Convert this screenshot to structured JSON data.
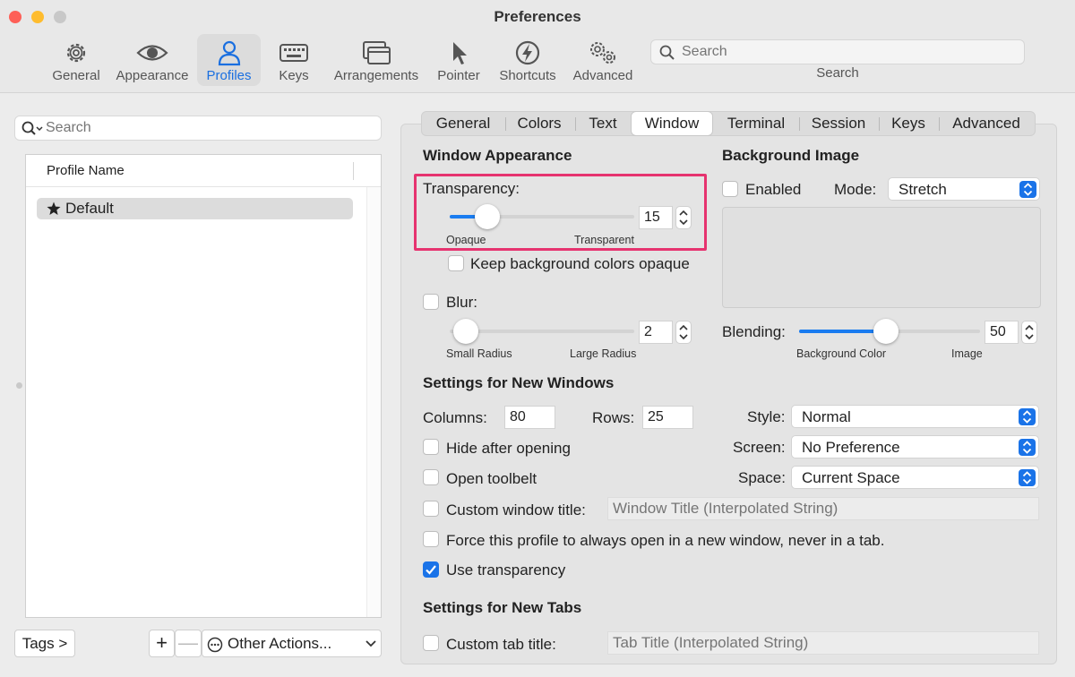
{
  "window": {
    "title": "Preferences"
  },
  "toolbar": {
    "items": [
      {
        "label": "General",
        "icon": "gear-icon"
      },
      {
        "label": "Appearance",
        "icon": "eye-icon"
      },
      {
        "label": "Profiles",
        "icon": "person-icon",
        "active": true
      },
      {
        "label": "Keys",
        "icon": "keyboard-icon"
      },
      {
        "label": "Arrangements",
        "icon": "windows-icon"
      },
      {
        "label": "Pointer",
        "icon": "pointer-icon"
      },
      {
        "label": "Shortcuts",
        "icon": "bolt-icon"
      },
      {
        "label": "Advanced",
        "icon": "gears-icon"
      }
    ],
    "search": {
      "placeholder": "Search",
      "caption": "Search"
    }
  },
  "left": {
    "search_placeholder": "Search",
    "column_header": "Profile Name",
    "profiles": [
      {
        "name": "Default",
        "icon": "star-icon"
      }
    ],
    "tags_label": "Tags >",
    "plus_label": "+",
    "minus_label": "—",
    "other_actions_label": "Other Actions..."
  },
  "tabs": [
    "General",
    "Colors",
    "Text",
    "Window",
    "Terminal",
    "Session",
    "Keys",
    "Advanced"
  ],
  "active_tab": "Window",
  "window_appearance": {
    "title": "Window Appearance",
    "transparency_label": "Transparency:",
    "transparency_value": "15",
    "transparency_fraction": 0.15,
    "opaque_label": "Opaque",
    "transparent_label": "Transparent",
    "keep_bg_opaque_label": "Keep background colors opaque",
    "keep_bg_opaque_checked": false,
    "blur_label": "Blur:",
    "blur_checked": false,
    "blur_value": "2",
    "small_radius_label": "Small Radius",
    "large_radius_label": "Large Radius"
  },
  "background_image": {
    "title": "Background Image",
    "enabled_label": "Enabled",
    "enabled_checked": false,
    "mode_label": "Mode:",
    "mode_value": "Stretch",
    "blending_label": "Blending:",
    "blending_value": "50",
    "background_color_label": "Background Color",
    "image_label": "Image"
  },
  "new_windows": {
    "title": "Settings for New Windows",
    "columns_label": "Columns:",
    "columns_value": "80",
    "rows_label": "Rows:",
    "rows_value": "25",
    "style_label": "Style:",
    "style_value": "Normal",
    "screen_label": "Screen:",
    "screen_value": "No Preference",
    "space_label": "Space:",
    "space_value": "Current Space",
    "hide_after_opening_label": "Hide after opening",
    "open_toolbelt_label": "Open toolbelt",
    "custom_window_title_label": "Custom window title:",
    "custom_window_title_placeholder": "Window Title (Interpolated String)",
    "force_new_window_label": "Force this profile to always open in a new window, never in a tab.",
    "use_transparency_label": "Use transparency",
    "use_transparency_checked": true
  },
  "new_tabs": {
    "title": "Settings for New Tabs",
    "custom_tab_title_label": "Custom tab title:",
    "custom_tab_title_placeholder": "Tab Title (Interpolated String)"
  },
  "colors": {
    "accent": "#1a73e8",
    "highlight": "#e6336f"
  }
}
